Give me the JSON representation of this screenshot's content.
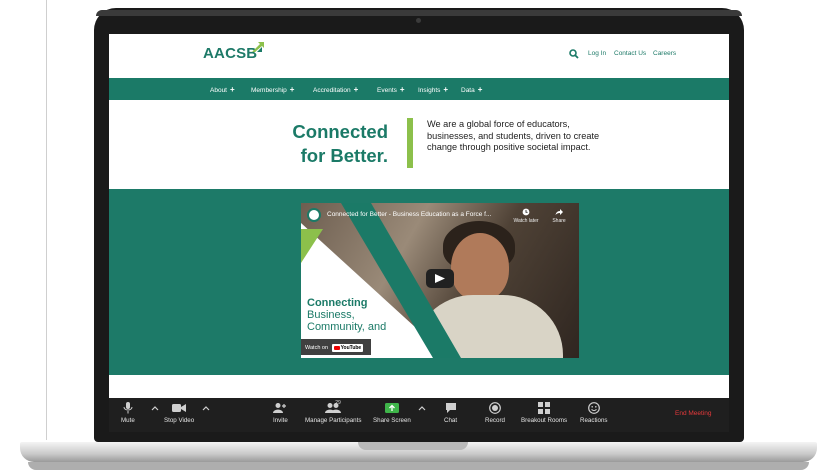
{
  "site": {
    "logo": "AACSB",
    "header_links": [
      "Log In",
      "Contact Us",
      "Careers"
    ],
    "nav": [
      "About",
      "Membership",
      "Accreditation",
      "Events",
      "Insights",
      "Data"
    ],
    "plus": "+",
    "hero_headline_1": "Connected",
    "hero_headline_2": "for Better.",
    "hero_text": "We are a global force of educators, businesses, and students, driven to create change through positive societal impact.",
    "brand_color": "#1b7a67",
    "accent_color": "#8cc04b"
  },
  "video": {
    "title": "Connected for Better - Business Education as a Force f...",
    "watch_later": "Watch later",
    "share": "Share",
    "overlay_line_1": "Connecting",
    "overlay_line_2": "Business,",
    "overlay_line_3": "Community, and",
    "watch_on": "Watch on",
    "youtube": "YouTube"
  },
  "toolbar": {
    "mute": "Mute",
    "stop_video": "Stop Video",
    "invite": "Invite",
    "manage_participants": "Manage Participants",
    "participant_count": "29",
    "share_screen": "Share Screen",
    "chat": "Chat",
    "record": "Record",
    "breakout_rooms": "Breakout Rooms",
    "reactions": "Reactions",
    "end_meeting": "End Meeting",
    "end_color": "#e5393b"
  }
}
